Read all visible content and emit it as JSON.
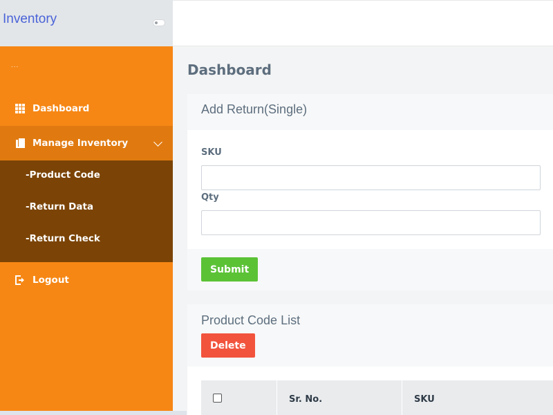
{
  "app": {
    "brand": "Inventory"
  },
  "sidebar": {
    "dots": "...",
    "items": [
      {
        "label": "Dashboard",
        "icon": "grid-icon"
      },
      {
        "label": "Manage Inventory",
        "icon": "book-icon",
        "expanded": true,
        "children": [
          "-Product Code",
          "-Return Data",
          "-Return Check"
        ]
      },
      {
        "label": "Logout",
        "icon": "logout-icon"
      }
    ]
  },
  "main": {
    "page_title": "Dashboard",
    "add_return": {
      "title": "Add Return(Single)",
      "sku_label": "SKU",
      "sku_value": "",
      "qty_label": "Qty",
      "qty_value": "",
      "submit_label": "Submit"
    },
    "product_list": {
      "title": "Product Code List",
      "delete_label": "Delete",
      "columns": [
        "",
        "Sr. No.",
        "SKU"
      ]
    }
  },
  "colors": {
    "sidebar": "#f68714",
    "sidebar_active": "#e07a10",
    "submenu": "#7b4406",
    "brand": "#4a63d8",
    "submit": "#5bc236",
    "delete": "#f2533d"
  }
}
